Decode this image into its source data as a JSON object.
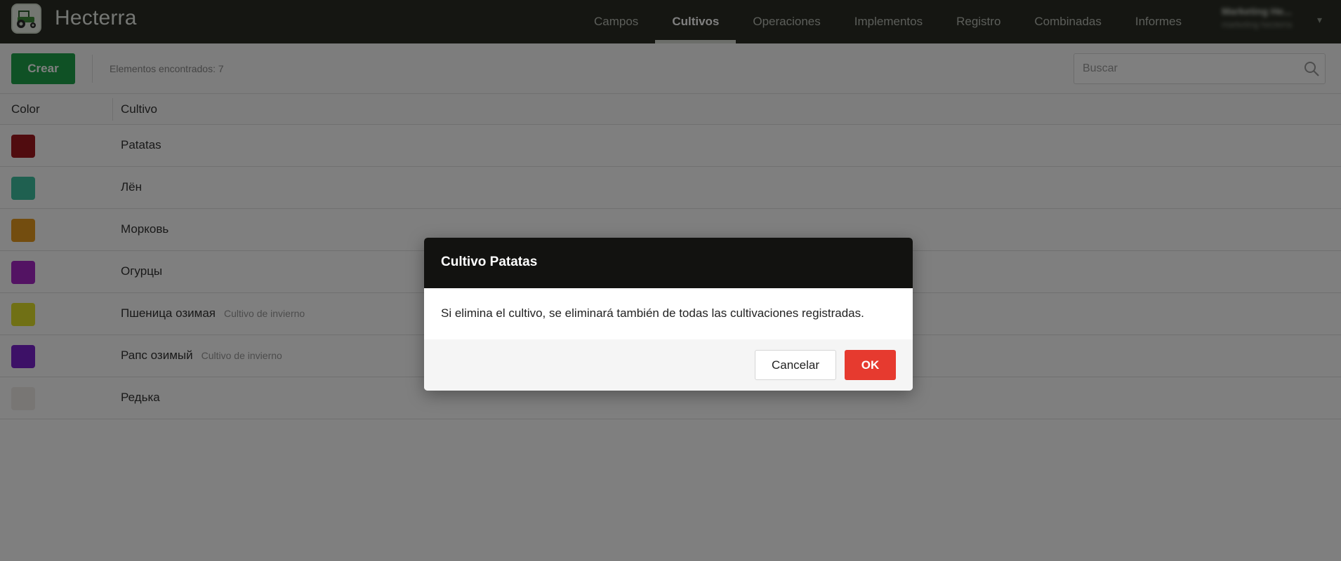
{
  "app": {
    "name": "Hecterra"
  },
  "nav": {
    "items": [
      {
        "label": "Campos",
        "active": false
      },
      {
        "label": "Cultivos",
        "active": true
      },
      {
        "label": "Operaciones",
        "active": false
      },
      {
        "label": "Implementos",
        "active": false
      },
      {
        "label": "Registro",
        "active": false
      },
      {
        "label": "Combinadas",
        "active": false
      },
      {
        "label": "Informes",
        "active": false
      }
    ]
  },
  "user": {
    "name": "Marketing Hе...",
    "subtitle": "marketing hecterra"
  },
  "toolbar": {
    "create_label": "Crear",
    "found_text": "Elementos encontrados: 7",
    "search_placeholder": "Buscar"
  },
  "table": {
    "headers": {
      "color": "Color",
      "crop": "Cultivo"
    },
    "rows": [
      {
        "name": "Patatas",
        "tag": "",
        "color": "#a0191f"
      },
      {
        "name": "Лён",
        "tag": "",
        "color": "#3fc1a0"
      },
      {
        "name": "Морковь",
        "tag": "",
        "color": "#e69a1e"
      },
      {
        "name": "Огурцы",
        "tag": "",
        "color": "#a726c7"
      },
      {
        "name": "Пшеница озимая",
        "tag": "Cultivo de invierno",
        "color": "#e0e02a"
      },
      {
        "name": "Рапс озимый",
        "tag": "Cultivo de invierno",
        "color": "#7a22cf"
      },
      {
        "name": "Редька",
        "tag": "",
        "color": "#f1ece9"
      }
    ]
  },
  "modal": {
    "title": "Cultivo Patatas",
    "message": "Si elimina el cultivo, se eliminará también de todas las cultivaciones registradas.",
    "cancel_label": "Cancelar",
    "ok_label": "OK"
  },
  "colors": {
    "topbar": "#2a2d25",
    "create_button": "#1fa34a",
    "ok_button": "#e63a2f",
    "modal_header": "#121210"
  }
}
